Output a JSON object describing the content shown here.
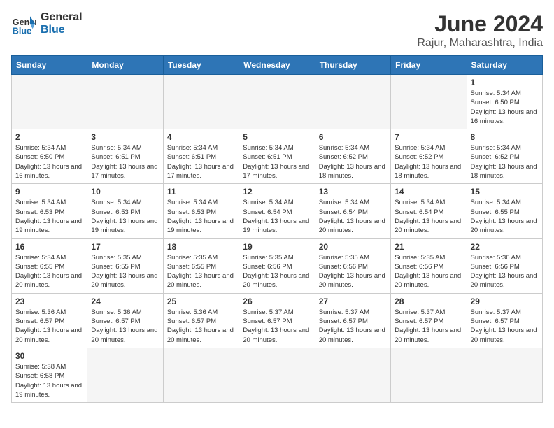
{
  "header": {
    "logo_general": "General",
    "logo_blue": "Blue",
    "title": "June 2024",
    "subtitle": "Rajur, Maharashtra, India"
  },
  "days_of_week": [
    "Sunday",
    "Monday",
    "Tuesday",
    "Wednesday",
    "Thursday",
    "Friday",
    "Saturday"
  ],
  "weeks": [
    [
      {
        "day": "",
        "empty": true
      },
      {
        "day": "",
        "empty": true
      },
      {
        "day": "",
        "empty": true
      },
      {
        "day": "",
        "empty": true
      },
      {
        "day": "",
        "empty": true
      },
      {
        "day": "",
        "empty": true
      },
      {
        "day": "1",
        "sunrise": "5:34 AM",
        "sunset": "6:50 PM",
        "daylight": "13 hours and 16 minutes."
      }
    ],
    [
      {
        "day": "2",
        "sunrise": "5:34 AM",
        "sunset": "6:50 PM",
        "daylight": "13 hours and 16 minutes."
      },
      {
        "day": "3",
        "sunrise": "5:34 AM",
        "sunset": "6:51 PM",
        "daylight": "13 hours and 17 minutes."
      },
      {
        "day": "4",
        "sunrise": "5:34 AM",
        "sunset": "6:51 PM",
        "daylight": "13 hours and 17 minutes."
      },
      {
        "day": "5",
        "sunrise": "5:34 AM",
        "sunset": "6:51 PM",
        "daylight": "13 hours and 17 minutes."
      },
      {
        "day": "6",
        "sunrise": "5:34 AM",
        "sunset": "6:52 PM",
        "daylight": "13 hours and 18 minutes."
      },
      {
        "day": "7",
        "sunrise": "5:34 AM",
        "sunset": "6:52 PM",
        "daylight": "13 hours and 18 minutes."
      },
      {
        "day": "8",
        "sunrise": "5:34 AM",
        "sunset": "6:52 PM",
        "daylight": "13 hours and 18 minutes."
      }
    ],
    [
      {
        "day": "9",
        "sunrise": "5:34 AM",
        "sunset": "6:53 PM",
        "daylight": "13 hours and 19 minutes."
      },
      {
        "day": "10",
        "sunrise": "5:34 AM",
        "sunset": "6:53 PM",
        "daylight": "13 hours and 19 minutes."
      },
      {
        "day": "11",
        "sunrise": "5:34 AM",
        "sunset": "6:53 PM",
        "daylight": "13 hours and 19 minutes."
      },
      {
        "day": "12",
        "sunrise": "5:34 AM",
        "sunset": "6:54 PM",
        "daylight": "13 hours and 19 minutes."
      },
      {
        "day": "13",
        "sunrise": "5:34 AM",
        "sunset": "6:54 PM",
        "daylight": "13 hours and 20 minutes."
      },
      {
        "day": "14",
        "sunrise": "5:34 AM",
        "sunset": "6:54 PM",
        "daylight": "13 hours and 20 minutes."
      },
      {
        "day": "15",
        "sunrise": "5:34 AM",
        "sunset": "6:55 PM",
        "daylight": "13 hours and 20 minutes."
      }
    ],
    [
      {
        "day": "16",
        "sunrise": "5:34 AM",
        "sunset": "6:55 PM",
        "daylight": "13 hours and 20 minutes."
      },
      {
        "day": "17",
        "sunrise": "5:35 AM",
        "sunset": "6:55 PM",
        "daylight": "13 hours and 20 minutes."
      },
      {
        "day": "18",
        "sunrise": "5:35 AM",
        "sunset": "6:55 PM",
        "daylight": "13 hours and 20 minutes."
      },
      {
        "day": "19",
        "sunrise": "5:35 AM",
        "sunset": "6:56 PM",
        "daylight": "13 hours and 20 minutes."
      },
      {
        "day": "20",
        "sunrise": "5:35 AM",
        "sunset": "6:56 PM",
        "daylight": "13 hours and 20 minutes."
      },
      {
        "day": "21",
        "sunrise": "5:35 AM",
        "sunset": "6:56 PM",
        "daylight": "13 hours and 20 minutes."
      },
      {
        "day": "22",
        "sunrise": "5:36 AM",
        "sunset": "6:56 PM",
        "daylight": "13 hours and 20 minutes."
      }
    ],
    [
      {
        "day": "23",
        "sunrise": "5:36 AM",
        "sunset": "6:57 PM",
        "daylight": "13 hours and 20 minutes."
      },
      {
        "day": "24",
        "sunrise": "5:36 AM",
        "sunset": "6:57 PM",
        "daylight": "13 hours and 20 minutes."
      },
      {
        "day": "25",
        "sunrise": "5:36 AM",
        "sunset": "6:57 PM",
        "daylight": "13 hours and 20 minutes."
      },
      {
        "day": "26",
        "sunrise": "5:37 AM",
        "sunset": "6:57 PM",
        "daylight": "13 hours and 20 minutes."
      },
      {
        "day": "27",
        "sunrise": "5:37 AM",
        "sunset": "6:57 PM",
        "daylight": "13 hours and 20 minutes."
      },
      {
        "day": "28",
        "sunrise": "5:37 AM",
        "sunset": "6:57 PM",
        "daylight": "13 hours and 20 minutes."
      },
      {
        "day": "29",
        "sunrise": "5:37 AM",
        "sunset": "6:57 PM",
        "daylight": "13 hours and 20 minutes."
      }
    ],
    [
      {
        "day": "30",
        "sunrise": "5:38 AM",
        "sunset": "6:58 PM",
        "daylight": "13 hours and 19 minutes."
      },
      {
        "day": "",
        "empty": true
      },
      {
        "day": "",
        "empty": true
      },
      {
        "day": "",
        "empty": true
      },
      {
        "day": "",
        "empty": true
      },
      {
        "day": "",
        "empty": true
      },
      {
        "day": "",
        "empty": true
      }
    ]
  ]
}
